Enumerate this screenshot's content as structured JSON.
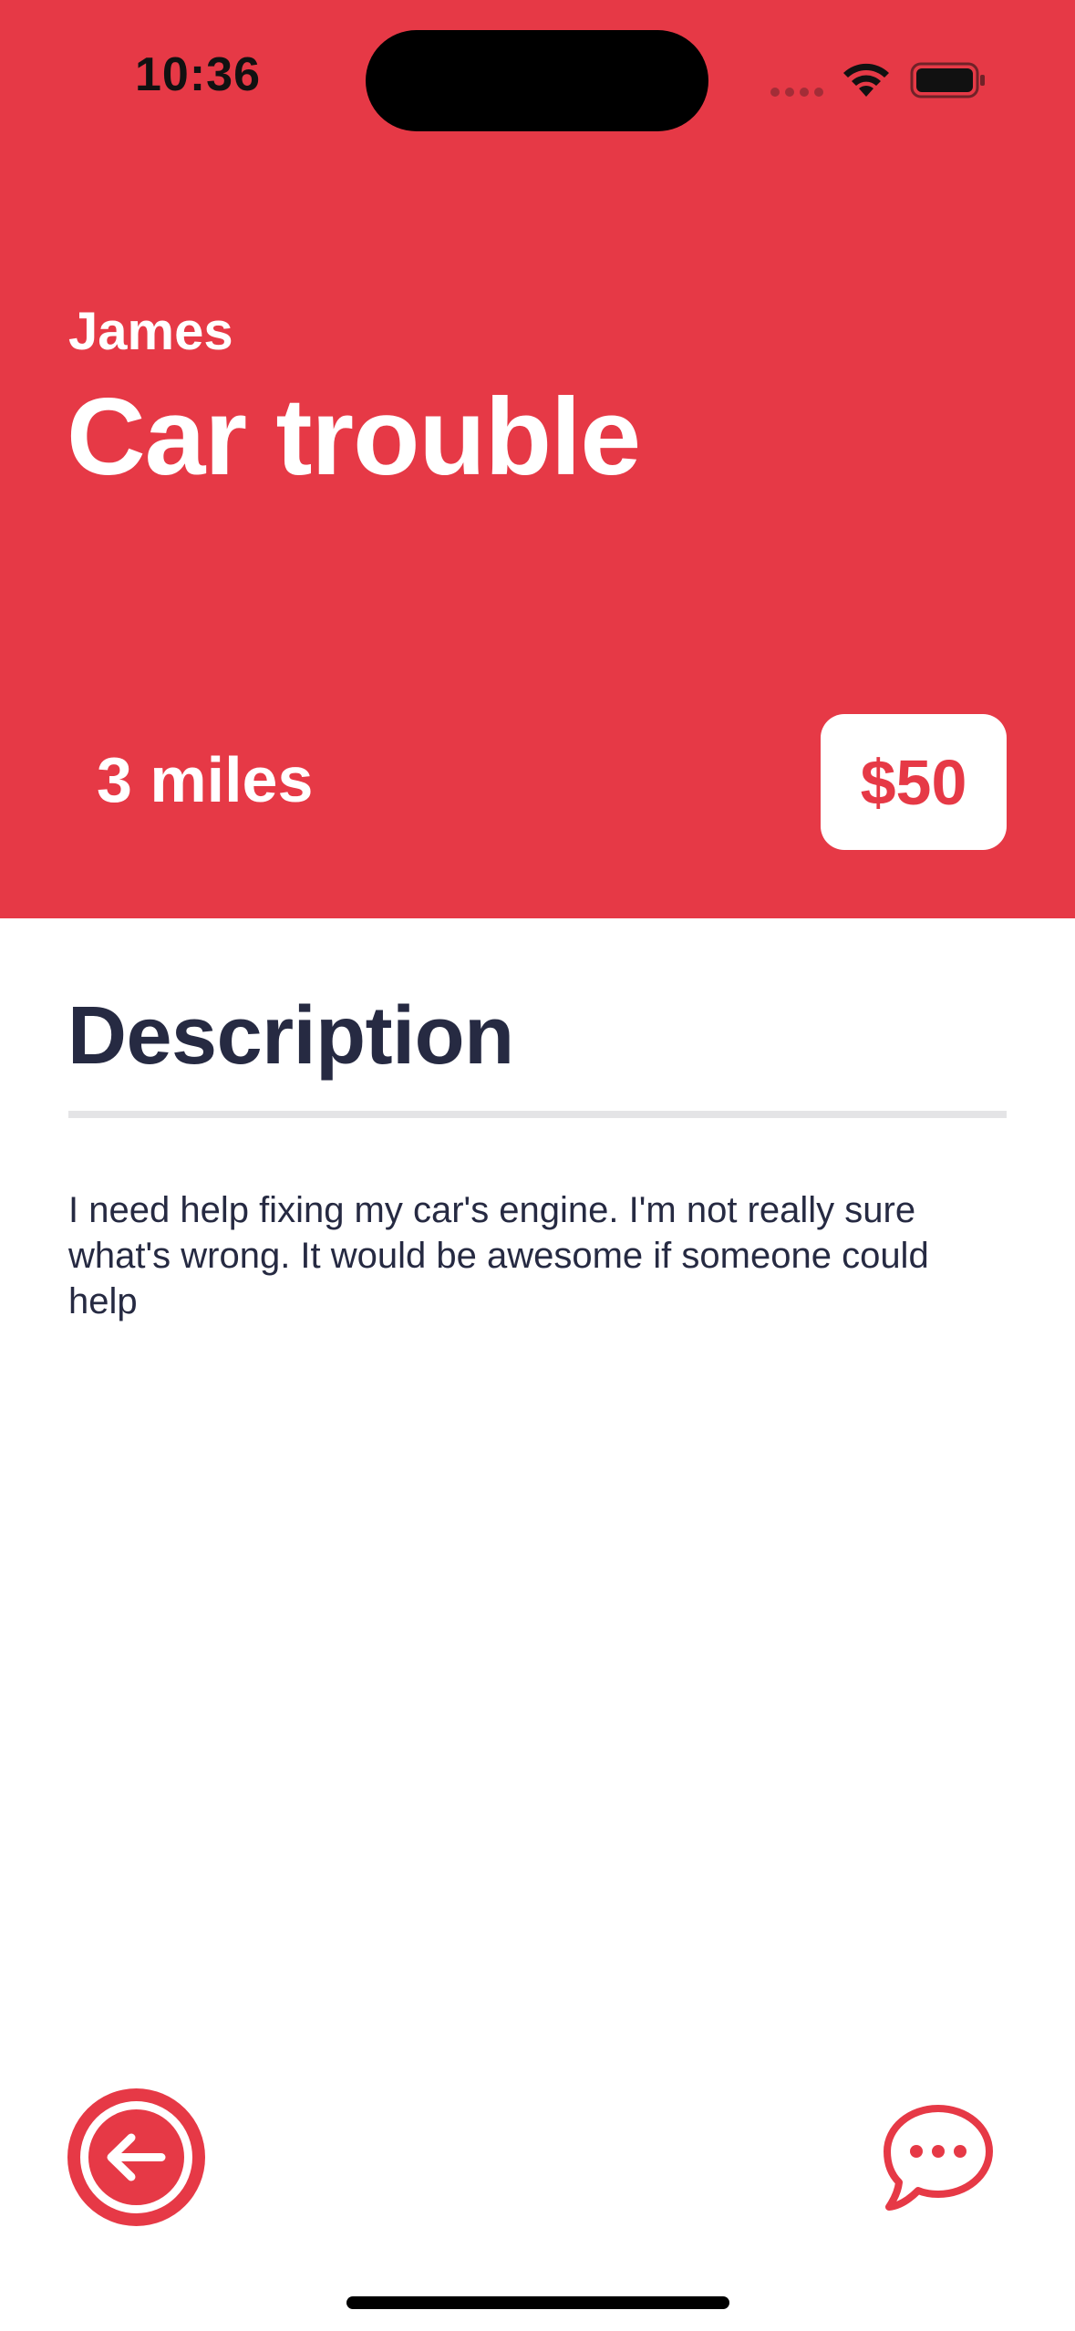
{
  "status_bar": {
    "time": "10:36"
  },
  "job": {
    "poster_name": "James",
    "title": "Car trouble",
    "distance": "3 miles",
    "price": "$50"
  },
  "details": {
    "heading": "Description",
    "body": "I need help fixing my car's engine. I'm not really sure what's wrong. It would be awesome if someone could help"
  },
  "icons": {
    "back": "back-arrow-circle-icon",
    "chat": "chat-bubble-icon",
    "wifi": "wifi-icon",
    "battery": "battery-icon",
    "signal": "cellular-signal-icon"
  },
  "colors": {
    "accent": "#e63946",
    "text_dark": "#262a42",
    "divider": "#e4e4e6",
    "background": "#ffffff"
  }
}
